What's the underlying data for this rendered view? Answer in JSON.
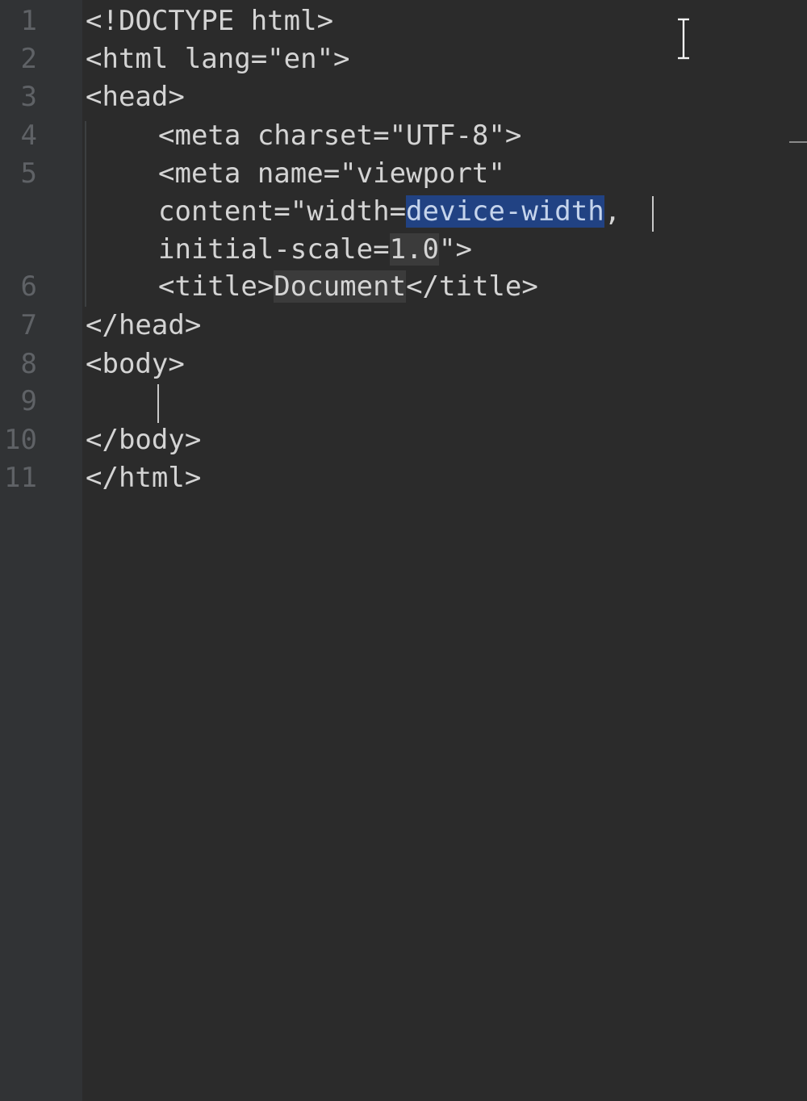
{
  "editor": {
    "line_numbers": [
      "1",
      "2",
      "3",
      "4",
      "5",
      "6",
      "7",
      "8",
      "9",
      "10",
      "11"
    ],
    "lines": {
      "l1": "<!DOCTYPE html>",
      "l2": "<html lang=\"en\">",
      "l3": "<head>",
      "l4": "<meta charset=\"UTF-8\">",
      "l5": "<meta name=\"viewport\"",
      "l5b_pre": "content=\"width=",
      "l5b_sel": "device-width",
      "l5b_post": ",",
      "l5c_pre": "initial-scale=",
      "l5c_hl": "1.0",
      "l5c_post": "\">",
      "l6_pre": "<title>",
      "l6_hl": "Document",
      "l6_post": "</title>",
      "l7": "</head>",
      "l8": "<body>",
      "l10": "</body>",
      "l11": "</html>"
    }
  },
  "colors": {
    "background": "#2b2b2b",
    "gutter": "#313335",
    "line_number": "#5f6266",
    "text": "#d4d4d4",
    "selection": "#214283"
  }
}
